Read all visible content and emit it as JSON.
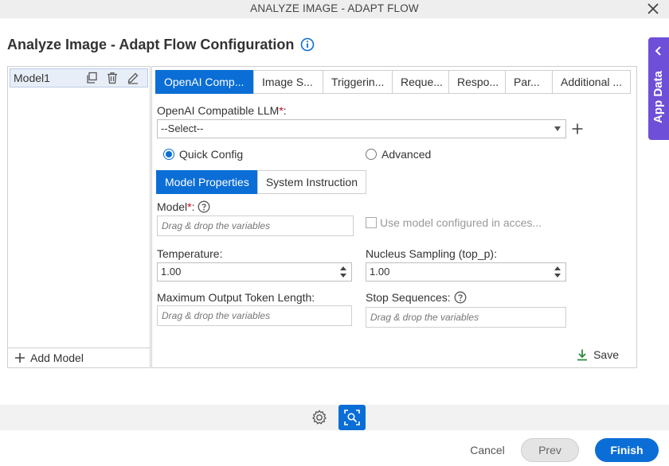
{
  "window": {
    "title": "ANALYZE IMAGE - ADAPT FLOW"
  },
  "page": {
    "heading": "Analyze Image - Adapt Flow Configuration"
  },
  "side_tab": {
    "label": "App Data"
  },
  "models": {
    "items": [
      {
        "label": "Model1"
      }
    ],
    "add_label": "Add Model"
  },
  "tabs": [
    {
      "label": "OpenAI Comp..."
    },
    {
      "label": "Image S..."
    },
    {
      "label": "Triggerin..."
    },
    {
      "label": "Reque..."
    },
    {
      "label": "Respo..."
    },
    {
      "label": "Par..."
    },
    {
      "label": "Additional ..."
    }
  ],
  "llm": {
    "label": "OpenAI Compatible LLM",
    "required_mark": "*",
    "label_suffix": ":",
    "selected": "--Select--"
  },
  "config_mode": {
    "quick": "Quick Config",
    "advanced": "Advanced",
    "selected": "Quick Config"
  },
  "subtabs": [
    {
      "label": "Model Properties"
    },
    {
      "label": "System Instruction"
    }
  ],
  "fields": {
    "model_label": "Model",
    "model_required": "*",
    "model_suffix": ":",
    "model_placeholder": "Drag & drop the variables",
    "use_model_checkbox": "Use model configured in acces...",
    "temperature_label": "Temperature:",
    "temperature_value": "1.00",
    "top_p_label": "Nucleus Sampling (top_p):",
    "top_p_value": "1.00",
    "max_tokens_label": "Maximum Output Token Length:",
    "max_tokens_placeholder": "Drag & drop the variables",
    "stop_label": "Stop Sequences:",
    "stop_placeholder": "Drag & drop the variables"
  },
  "save_label": "Save",
  "footer": {
    "cancel": "Cancel",
    "prev": "Prev",
    "finish": "Finish"
  },
  "colors": {
    "accent": "#0b6ed6",
    "app_data": "#6d4fd8",
    "save_icon": "#2e8b3a"
  }
}
